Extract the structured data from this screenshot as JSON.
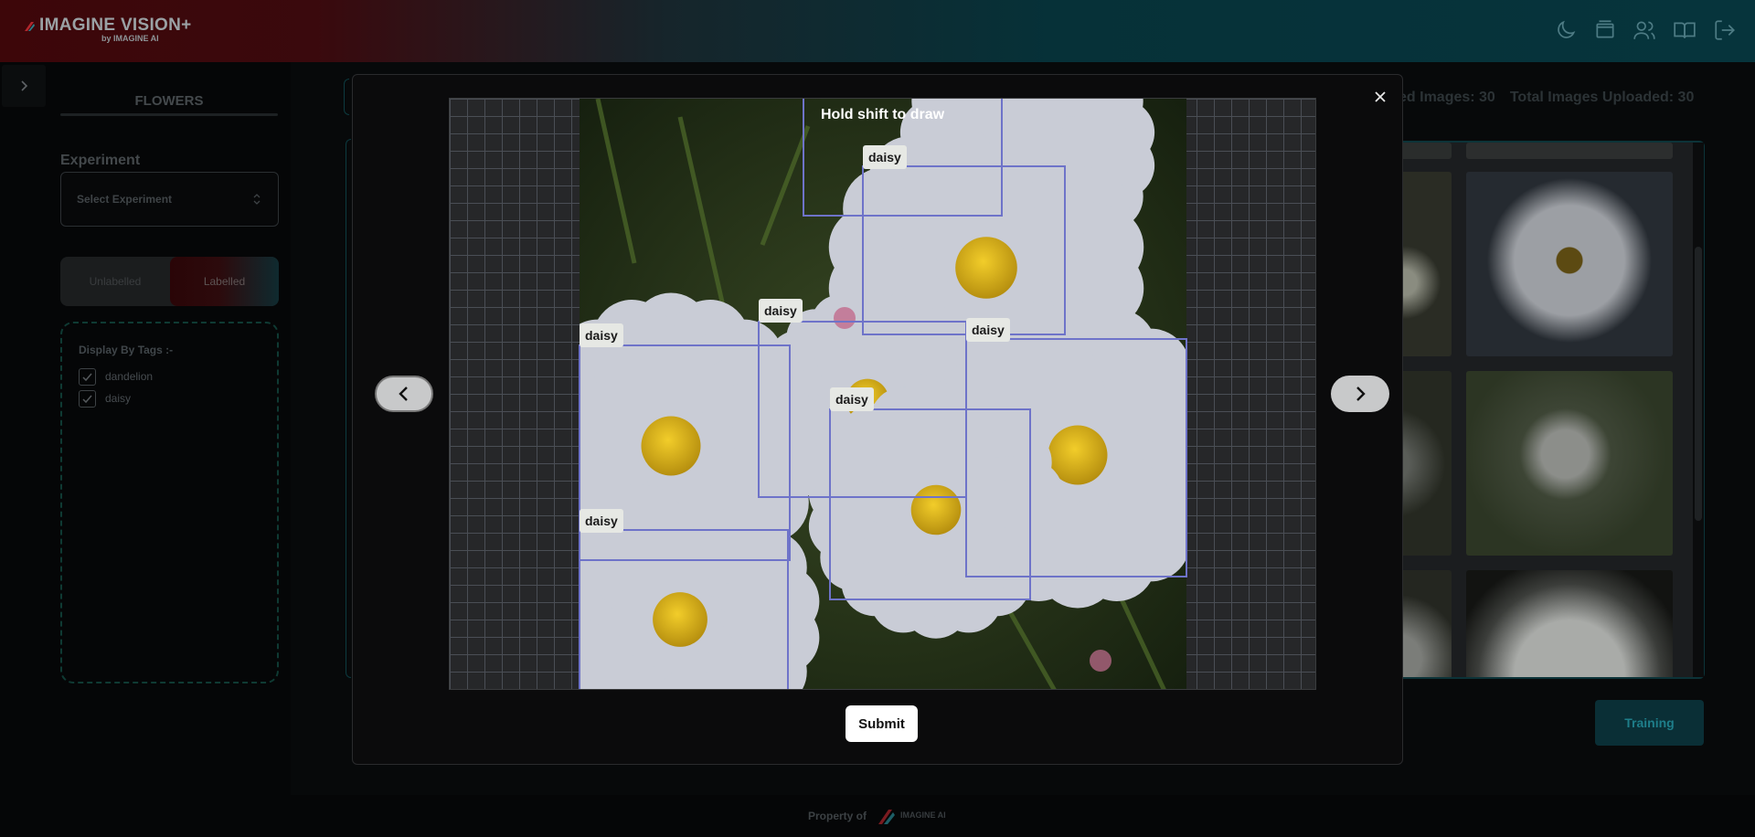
{
  "app": {
    "logo_title": "IMAGINE VISION+",
    "logo_subtitle": "by IMAGINE AI",
    "header_icons": [
      "moon-icon",
      "gallery-icon",
      "users-icon",
      "book-icon",
      "logout-icon"
    ]
  },
  "sidebar": {
    "project_title": "FLOWERS",
    "experiment_label": "Experiment",
    "experiment_select_placeholder": "Select Experiment",
    "toggle": {
      "unlabelled": "Unlabelled",
      "labelled": "Labelled",
      "active": "Labelled"
    },
    "tags_title": "Display By Tags :-",
    "tags": [
      {
        "name": "dandelion",
        "checked": true
      },
      {
        "name": "daisy",
        "checked": true
      }
    ]
  },
  "background": {
    "labelled_images_text": "ed Images: 30",
    "total_uploaded_text": "Total Images Uploaded: 30",
    "training_button": "Training"
  },
  "modal": {
    "hint": "Hold shift to draw",
    "submit_label": "Submit",
    "annotations": [
      {
        "label": "daisy",
        "show_label": true
      },
      {
        "label": "daisy",
        "show_label": false
      },
      {
        "label": "daisy",
        "show_label": true
      },
      {
        "label": "daisy",
        "show_label": true
      },
      {
        "label": "daisy",
        "show_label": true
      },
      {
        "label": "daisy",
        "show_label": true
      },
      {
        "label": "daisy",
        "show_label": true
      }
    ]
  },
  "footer": {
    "property_text": "Property of",
    "logo_text": "IMAGINE AI"
  },
  "colors": {
    "accent_teal": "#0c3a3f",
    "accent_red": "#3d0609",
    "bbox": "#6e73c9"
  }
}
